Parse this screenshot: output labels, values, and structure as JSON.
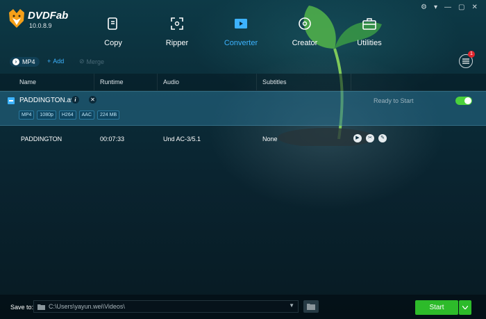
{
  "window": {
    "controls": [
      "⚙",
      "▾",
      "—",
      "▢",
      "✕"
    ]
  },
  "logo": {
    "name": "DVDFab",
    "version": "10.0.8.9"
  },
  "nav": [
    {
      "label": "Copy",
      "icon": "copy-icon",
      "active": false
    },
    {
      "label": "Ripper",
      "icon": "ripper-icon",
      "active": false
    },
    {
      "label": "Converter",
      "icon": "converter-icon",
      "active": true
    },
    {
      "label": "Creator",
      "icon": "creator-icon",
      "active": false
    },
    {
      "label": "Utilities",
      "icon": "utilities-icon",
      "active": false
    }
  ],
  "toolbar": {
    "profile": "MP4",
    "add": "Add",
    "merge": "Merge",
    "task_badge": "1"
  },
  "columns": [
    "Name",
    "Runtime",
    "Audio",
    "Subtitles"
  ],
  "file": {
    "name": "PADDINGTON.avi",
    "status": "Ready to Start",
    "tags": [
      "MP4",
      "1080p",
      "H264",
      "AAC",
      "224 MB"
    ]
  },
  "track": {
    "name": "PADDINGTON",
    "runtime": "00:07:33",
    "audio": "Und AC-3/5.1",
    "subtitles": "None"
  },
  "bottom": {
    "save_label": "Save to:",
    "save_path": "C:\\Users\\yayun.wei\\Videos\\",
    "start": "Start"
  },
  "colors": {
    "accent": "#3db3ff",
    "start": "#2dbb2a",
    "toggle_on": "#4bd13c",
    "badge": "#e0262e"
  }
}
